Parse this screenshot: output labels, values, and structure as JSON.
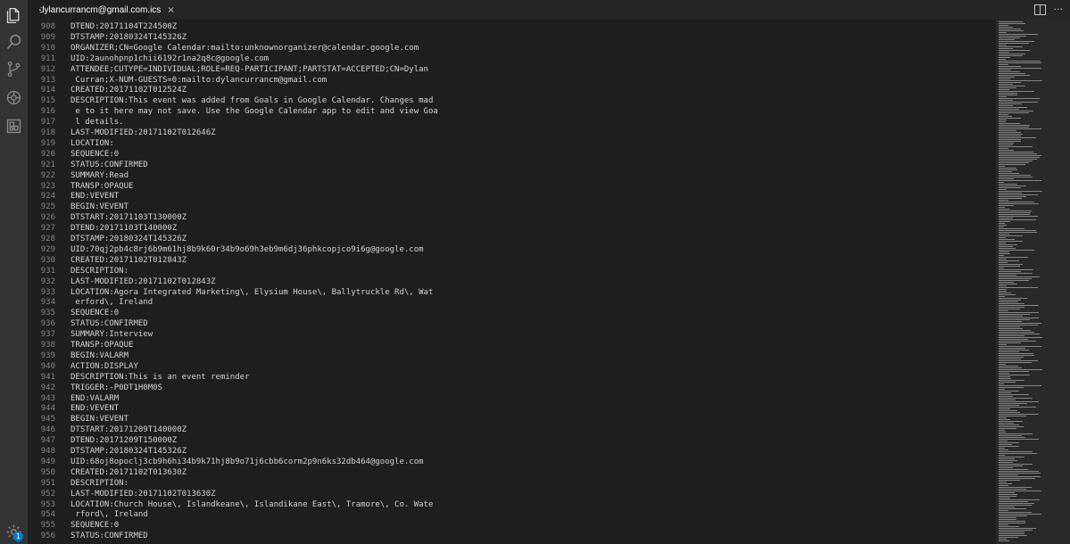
{
  "tab": {
    "title": "dylancurrancm@gmail.com.ics",
    "close_glyph": "×"
  },
  "activity_bar": [
    {
      "name": "explorer-icon"
    },
    {
      "name": "search-icon"
    },
    {
      "name": "source-control-icon"
    },
    {
      "name": "debug-icon"
    },
    {
      "name": "extensions-icon"
    }
  ],
  "settings": {
    "icon": "gear-icon",
    "badge": "1"
  },
  "editor_actions": {
    "split": "split-editor-icon",
    "more": "···"
  },
  "lines": [
    {
      "n": "908",
      "t": "DTEND:20171104T224500Z"
    },
    {
      "n": "909",
      "t": "DTSTAMP:20180324T145326Z"
    },
    {
      "n": "910",
      "t": "ORGANIZER;CN=Google Calendar:mailto:unknownorganizer@calendar.google.com"
    },
    {
      "n": "911",
      "t": "UID:2aunohpnp1chii6192r1na2q8c@google.com"
    },
    {
      "n": "912",
      "t": "ATTENDEE;CUTYPE=INDIVIDUAL;ROLE=REQ-PARTICIPANT;PARTSTAT=ACCEPTED;CN=Dylan"
    },
    {
      "n": "913",
      "t": " Curran;X-NUM-GUESTS=0:mailto:dylancurrancm@gmail.com"
    },
    {
      "n": "914",
      "t": "CREATED:20171102T012524Z"
    },
    {
      "n": "915",
      "t": "DESCRIPTION:This event was added from Goals in Google Calendar. Changes mad"
    },
    {
      "n": "916",
      "t": " e to it here may not save. Use the Google Calendar app to edit and view Goa"
    },
    {
      "n": "917",
      "t": " l details."
    },
    {
      "n": "918",
      "t": "LAST-MODIFIED:20171102T012646Z"
    },
    {
      "n": "919",
      "t": "LOCATION:"
    },
    {
      "n": "920",
      "t": "SEQUENCE:0"
    },
    {
      "n": "921",
      "t": "STATUS:CONFIRMED"
    },
    {
      "n": "922",
      "t": "SUMMARY:Read"
    },
    {
      "n": "923",
      "t": "TRANSP:OPAQUE"
    },
    {
      "n": "924",
      "t": "END:VEVENT"
    },
    {
      "n": "925",
      "t": "BEGIN:VEVENT"
    },
    {
      "n": "926",
      "t": "DTSTART:20171103T130000Z"
    },
    {
      "n": "927",
      "t": "DTEND:20171103T140000Z"
    },
    {
      "n": "928",
      "t": "DTSTAMP:20180324T145326Z"
    },
    {
      "n": "929",
      "t": "UID:70qj2pb4c8rj6b9m61hj8b9k60r34b9o69h3eb9m6dj36phkcopjco9i6g@google.com"
    },
    {
      "n": "930",
      "t": "CREATED:20171102T012843Z"
    },
    {
      "n": "931",
      "t": "DESCRIPTION:"
    },
    {
      "n": "932",
      "t": "LAST-MODIFIED:20171102T012843Z"
    },
    {
      "n": "933",
      "t": "LOCATION:Agora Integrated Marketing\\, Elysium House\\, Ballytruckle Rd\\, Wat"
    },
    {
      "n": "934",
      "t": " erford\\, Ireland"
    },
    {
      "n": "935",
      "t": "SEQUENCE:0"
    },
    {
      "n": "936",
      "t": "STATUS:CONFIRMED"
    },
    {
      "n": "937",
      "t": "SUMMARY:Interview"
    },
    {
      "n": "938",
      "t": "TRANSP:OPAQUE"
    },
    {
      "n": "939",
      "t": "BEGIN:VALARM"
    },
    {
      "n": "940",
      "t": "ACTION:DISPLAY"
    },
    {
      "n": "941",
      "t": "DESCRIPTION:This is an event reminder"
    },
    {
      "n": "942",
      "t": "TRIGGER:-P0DT1H0M0S"
    },
    {
      "n": "943",
      "t": "END:VALARM"
    },
    {
      "n": "944",
      "t": "END:VEVENT"
    },
    {
      "n": "945",
      "t": "BEGIN:VEVENT"
    },
    {
      "n": "946",
      "t": "DTSTART:20171209T140000Z"
    },
    {
      "n": "947",
      "t": "DTEND:20171209T150000Z"
    },
    {
      "n": "948",
      "t": "DTSTAMP:20180324T145326Z"
    },
    {
      "n": "949",
      "t": "UID:68oj8opoclj3cb9h6hi34b9k71hj8b9o71j6cbb6corm2p9n6ks32db464@google.com"
    },
    {
      "n": "950",
      "t": "CREATED:20171102T013630Z"
    },
    {
      "n": "951",
      "t": "DESCRIPTION:"
    },
    {
      "n": "952",
      "t": "LAST-MODIFIED:20171102T013630Z"
    },
    {
      "n": "953",
      "t": "LOCATION:Church House\\, Islandkeane\\, Islandikane East\\, Tramore\\, Co. Wate"
    },
    {
      "n": "954",
      "t": " rford\\, Ireland"
    },
    {
      "n": "955",
      "t": "SEQUENCE:0"
    },
    {
      "n": "956",
      "t": "STATUS:CONFIRMED"
    }
  ]
}
